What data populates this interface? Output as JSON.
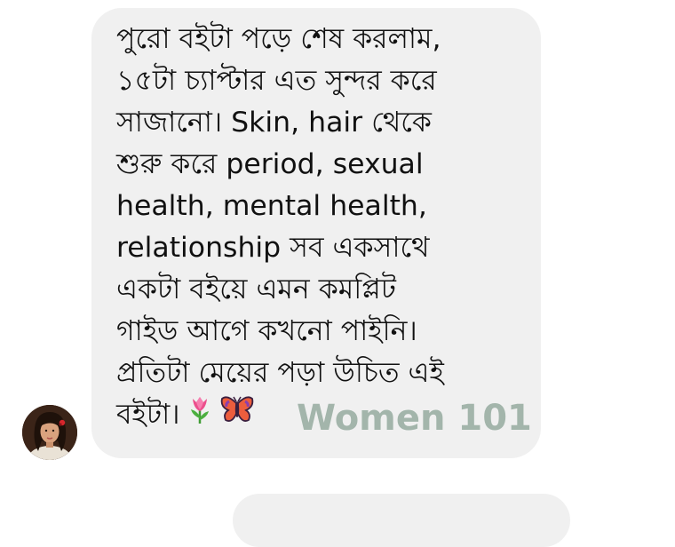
{
  "message": {
    "lines": [
      "পুরো বইটা পড়ে শেষ করলাম,",
      "১৫টা চ্যাপ্টার এত সুন্দর করে",
      "সাজানো। Skin, hair থেকে",
      "শুরু করে period, sexual",
      "health, mental health,",
      "relationship সব একসাথে",
      "একটা বইয়ে এমন কমপ্লিট",
      "গাইড আগে কখনো পাইনি।",
      "প্রতিটা মেয়ের পড়া উচিত এই",
      "বইটা।"
    ],
    "emojis": [
      "tulip-emoji",
      "butterfly-emoji"
    ]
  },
  "watermark": "Women 101",
  "colors": {
    "bubble": "#f0f0f0",
    "text": "#111111",
    "watermark": "#9fb2a8"
  }
}
